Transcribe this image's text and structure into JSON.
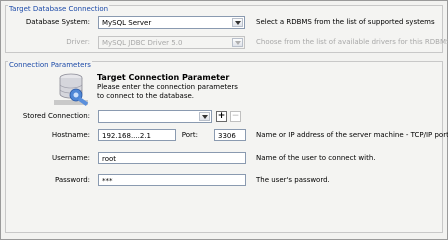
{
  "target_db": {
    "title": "Target Database Connection",
    "database_system_label": "Database System:",
    "database_system_value": "MySQL Server",
    "database_system_help": "Select a RDBMS from the list of supported systems",
    "driver_label": "Driver:",
    "driver_value": "MySQL JDBC Driver 5.0",
    "driver_help": "Choose from the list of available drivers for this RDBMS"
  },
  "connection": {
    "title": "Connection Parameters",
    "heading": "Target Connection Parameter",
    "info": "Please enter the connection parameters to connect to the database.",
    "stored_connection_label": "Stored Connection:",
    "stored_connection_value": "",
    "add_label": "+",
    "remove_label": "−",
    "hostname_label": "Hostname:",
    "hostname_value": "192.168....2.1",
    "port_label": "Port:",
    "port_value": "3306",
    "hostname_help": "Name or IP address of the server machine - TCP/IP port",
    "username_label": "Username:",
    "username_value": "root",
    "username_help": "Name of the user to connect with.",
    "password_label": "Password:",
    "password_value": "***",
    "password_help": "The user's password."
  }
}
